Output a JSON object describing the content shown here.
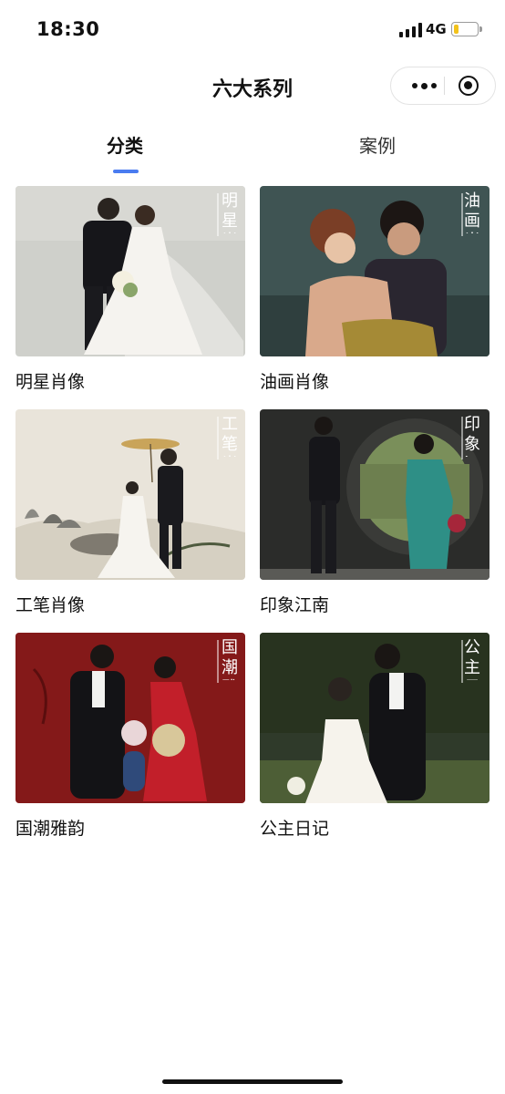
{
  "status_bar": {
    "time": "18:30",
    "network": "4G",
    "battery_level": 0.2
  },
  "nav": {
    "title": "六大系列",
    "more_icon": "more-dots-icon",
    "close_icon": "target-icon"
  },
  "tabs": [
    {
      "label": "分类",
      "active": true
    },
    {
      "label": "案例",
      "active": false
    }
  ],
  "series": [
    {
      "label": "明星肖像",
      "overlay": "明星肖像"
    },
    {
      "label": "油画肖像",
      "overlay": "油画肖像"
    },
    {
      "label": "工笔肖像",
      "overlay": "工笔肖像"
    },
    {
      "label": "印象江南",
      "overlay": "印象江南"
    },
    {
      "label": "国潮雅韵",
      "overlay": "国潮雅韵"
    },
    {
      "label": "公主日记",
      "overlay": "公主日记"
    }
  ],
  "colors": {
    "accent": "#4a7cf0",
    "battery": "#f2c21b"
  }
}
